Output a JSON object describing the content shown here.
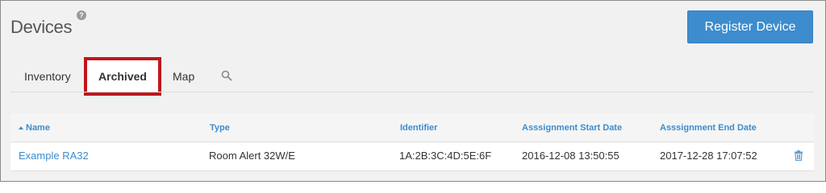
{
  "header": {
    "title": "Devices",
    "help_icon": "help-circle-icon",
    "register_button_label": "Register Device"
  },
  "tabs": [
    {
      "label": "Inventory",
      "active": false
    },
    {
      "label": "Archived",
      "active": true
    },
    {
      "label": "Map",
      "active": false
    }
  ],
  "search_icon": "search-icon",
  "table": {
    "columns": [
      "Name",
      "Type",
      "Identifier",
      "Asssignment Start Date",
      "Asssignment End Date"
    ],
    "sort_column": "Name",
    "sort_direction": "ascending",
    "rows": [
      {
        "name": "Example RA32",
        "type": "Room Alert 32W/E",
        "identifier": "1A:2B:3C:4D:5E:6F",
        "start_date": "2016-12-08 13:50:55",
        "end_date": "2017-12-28 17:07:52",
        "action_icon": "trash-icon"
      }
    ]
  },
  "colors": {
    "accent": "#3d8ccd",
    "highlight_border": "#c0161c",
    "background": "#f1f1f1"
  }
}
